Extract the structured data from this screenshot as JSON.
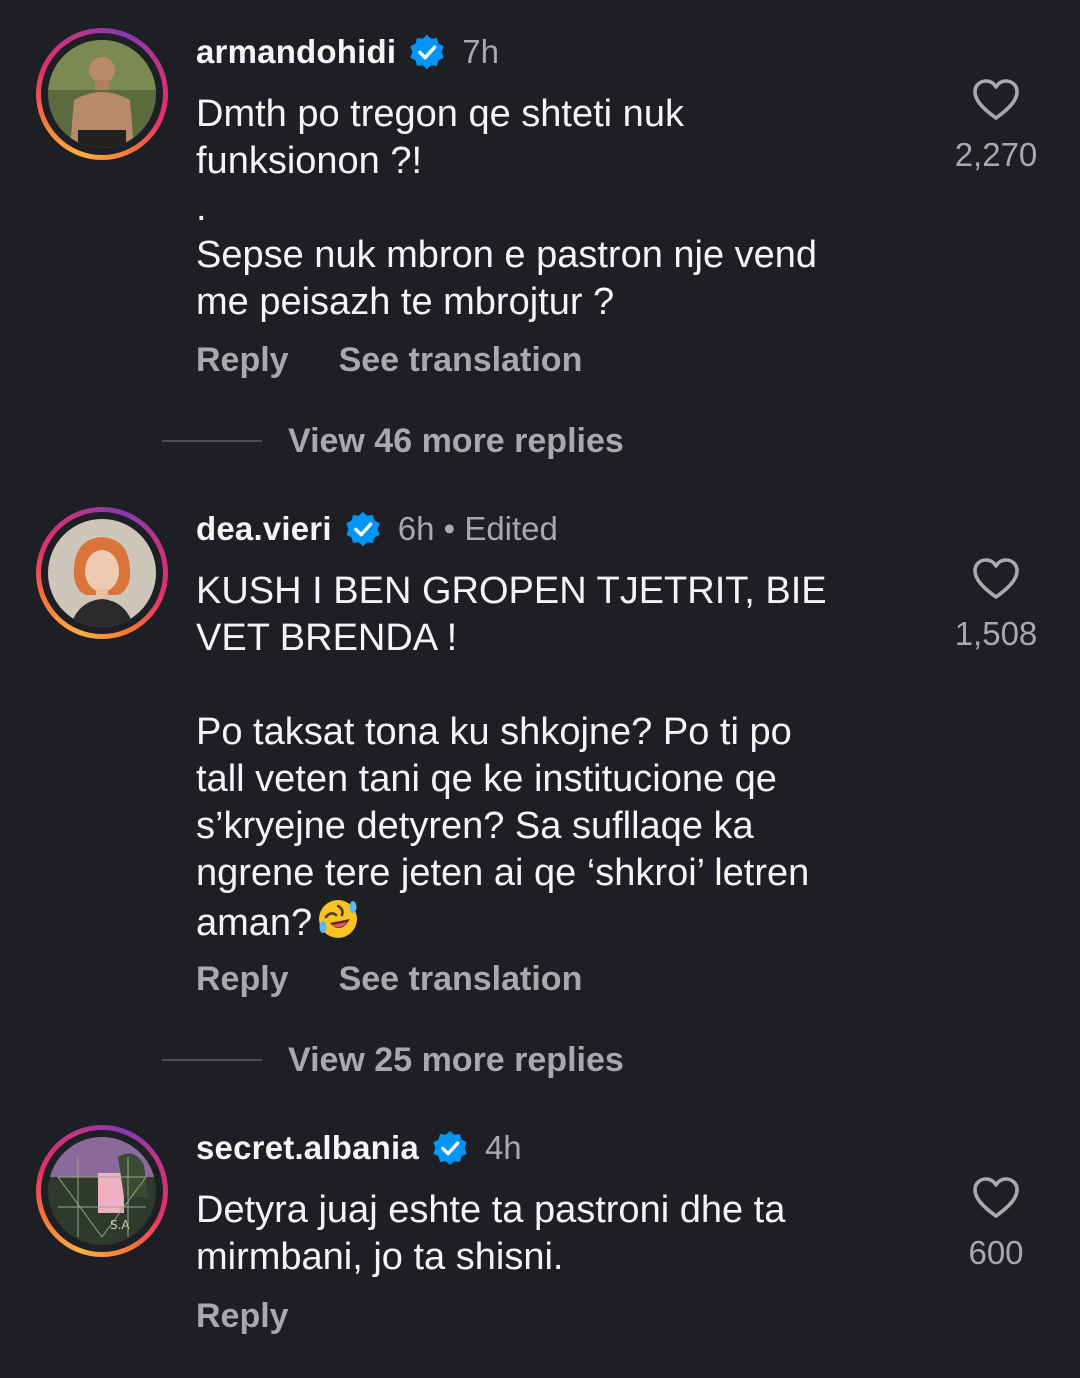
{
  "comments": [
    {
      "username": "armandohidi",
      "meta": "7h",
      "text": "Dmth po tregon qe shteti nuk\nfunksionon ?!\n.\nSepse nuk mbron e pastron nje vend\nme peisazh te mbrojtur ?",
      "likes": "2,270",
      "reply_label": "Reply",
      "translate_label": "See translation",
      "view_replies": "View 46 more replies"
    },
    {
      "username": "dea.vieri",
      "meta": "6h • Edited",
      "text": "KUSH I BEN GROPEN TJETRIT, BIE\nVET BRENDA !\n\nPo taksat tona ku shkojne? Po ti po\ntall veten tani qe ke institucione qe\ns’kryejne detyren? Sa sufllaqe ka\nngrene tere jeten ai qe ‘shkroi’ letren\naman?",
      "emoji": "rolling-on-floor-laughing-emoji",
      "likes": "1,508",
      "reply_label": "Reply",
      "translate_label": "See translation",
      "view_replies": "View 25 more replies"
    },
    {
      "username": "secret.albania",
      "meta": "4h",
      "text": "Detyra juaj eshte ta pastroni dhe ta\nmirmbani, jo ta shisni.",
      "likes": "600",
      "reply_label": "Reply"
    }
  ],
  "colors": {
    "background": "#1d1f25",
    "primary_text": "#f5f5f5",
    "secondary_text": "#a8a8ad",
    "verified_badge": "#0095f6"
  }
}
